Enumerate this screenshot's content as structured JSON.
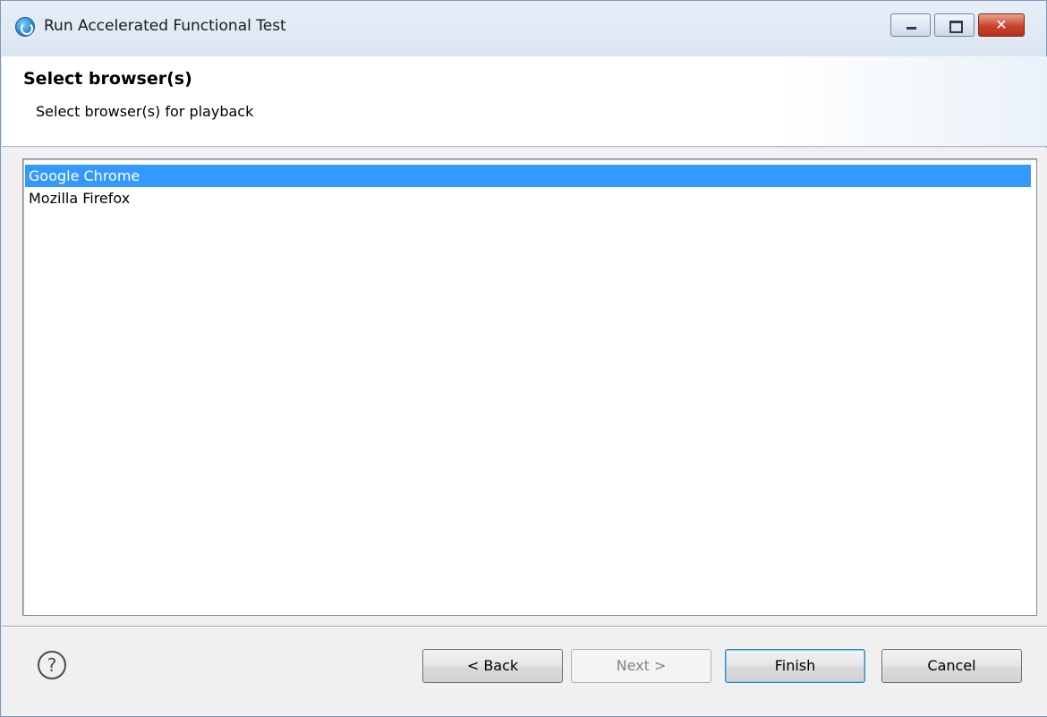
{
  "window": {
    "title": "Run Accelerated Functional Test",
    "icon": "app-globe-icon",
    "caption_buttons": [
      "minimize-icon",
      "maximize-icon",
      "close-icon"
    ],
    "close_glyph": "✕"
  },
  "header": {
    "title": "Select browser(s)",
    "subtitle": "Select browser(s) for playback"
  },
  "browser_list": {
    "items": [
      {
        "label": "Google Chrome",
        "selected": true
      },
      {
        "label": "Mozilla Firefox",
        "selected": false
      }
    ],
    "selection_color": "#3399ff"
  },
  "footer": {
    "help_glyph": "?",
    "back_label": "< Back",
    "next_label": "Next >",
    "finish_label": "Finish",
    "cancel_label": "Cancel",
    "next_enabled": false
  }
}
